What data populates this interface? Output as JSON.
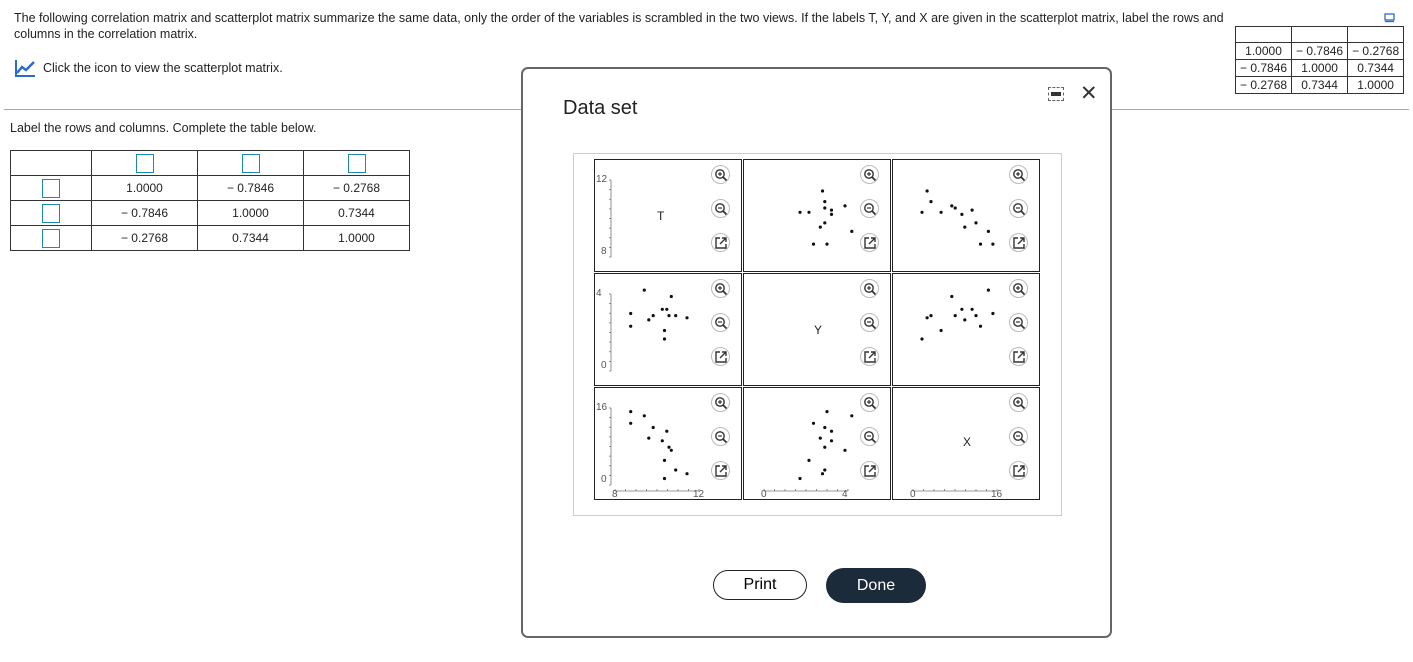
{
  "question": {
    "text": "The following correlation matrix and scatterplot matrix summarize the same data, only the order of the variables is scrambled in the two views. If the labels T, Y, and X are given in the scatterplot matrix, label the rows and columns in the correlation matrix.",
    "chart_link": "Click the icon to view the scatterplot matrix.",
    "instruction": "Label the rows and columns. Complete the table below."
  },
  "corr_matrix": {
    "rows": [
      [
        "1.0000",
        "− 0.7846",
        "− 0.2768"
      ],
      [
        "− 0.7846",
        "1.0000",
        "0.7344"
      ],
      [
        "− 0.2768",
        "0.7344",
        "1.0000"
      ]
    ]
  },
  "answer_table": {
    "rows": [
      [
        "1.0000",
        "− 0.7846",
        "− 0.2768"
      ],
      [
        "− 0.7846",
        "1.0000",
        "0.7344"
      ],
      [
        "− 0.2768",
        "0.7344",
        "1.0000"
      ]
    ]
  },
  "modal": {
    "title": "Data set",
    "print_label": "Print",
    "done_label": "Done"
  },
  "icons": {
    "chart": "chart-line-icon",
    "collapse": "collapse-icon",
    "minimize": "minimize-icon",
    "close": "close-icon",
    "zoom_in": "zoom-in-icon",
    "zoom_out": "zoom-out-icon",
    "expand": "expand-icon"
  },
  "colors": {
    "link_blue": "#2b6cc4",
    "input_border": "#1a8ab0",
    "done_bg": "#1c2b3a"
  },
  "chart_data": {
    "type": "scatter",
    "variables": [
      "T",
      "Y",
      "X"
    ],
    "ticks": {
      "T": [
        "8",
        "12"
      ],
      "Y": [
        "0",
        "4"
      ],
      "X": [
        "0",
        "16"
      ]
    },
    "axis_ranges": {
      "T": [
        8,
        12
      ],
      "Y": [
        0,
        4
      ],
      "X": [
        0,
        16
      ]
    },
    "points": {
      "T": [
        8.7,
        10.5,
        9.7,
        10.1,
        10.7,
        10.3,
        9.5,
        10.4,
        10.2,
        8.7,
        9.3,
        10.2,
        11.2
      ],
      "Y": [
        2.8,
        3.6,
        2.7,
        3.0,
        2.7,
        3.0,
        2.5,
        2.7,
        2.0,
        2.2,
        3.9,
        1.6,
        2.6
      ],
      "X": [
        14.2,
        6.9,
        11.2,
        8.7,
        3.2,
        10.5,
        9.2,
        7.5,
        5.0,
        12.0,
        13.4,
        1.6,
        2.5
      ]
    }
  }
}
